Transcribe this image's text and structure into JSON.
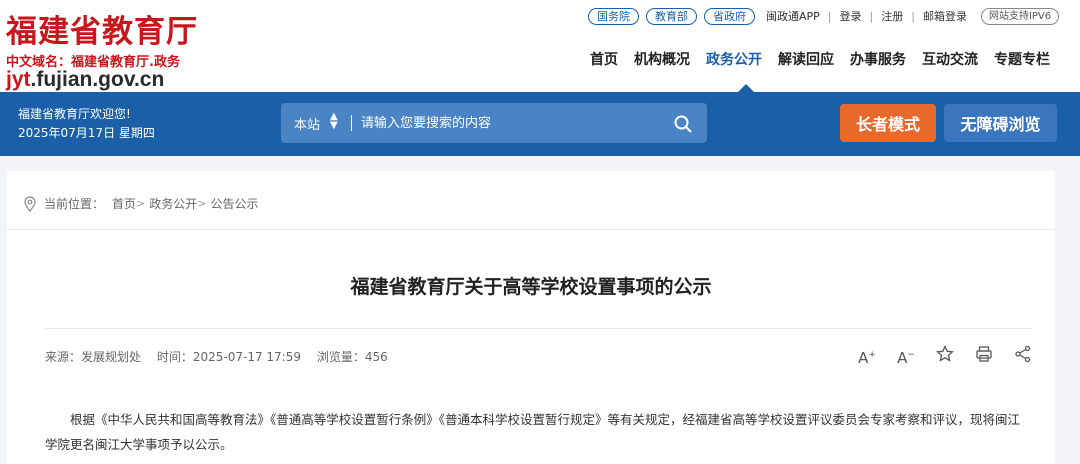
{
  "logo": {
    "title": "福建省教育厅",
    "cn_domain": "中文域名：福建省教育厅.政务",
    "url_prefix": "jyt",
    "url_rest": ".fujian.gov.cn"
  },
  "toplinks": {
    "pills": [
      "国务院",
      "教育部",
      "省政府"
    ],
    "links": [
      "闽政通APP",
      "登录",
      "注册",
      "邮箱登录"
    ],
    "ipv6": "网站支持IPV6"
  },
  "nav": {
    "items": [
      "首页",
      "机构概况",
      "政务公开",
      "解读回应",
      "办事服务",
      "互动交流",
      "专题专栏"
    ],
    "active": "政务公开"
  },
  "bluebar": {
    "welcome": "福建省教育厅欢迎您!",
    "date": "2025年07月17日 星期四",
    "search_scope": "本站",
    "search_placeholder": "请输入您要搜索的内容",
    "elder_mode": "长者模式",
    "accessible": "无障碍浏览"
  },
  "breadcrumb": {
    "label": "当前位置：",
    "items": [
      "首页",
      "政务公开",
      "公告公示"
    ]
  },
  "article": {
    "title": "福建省教育厅关于高等学校设置事项的公示",
    "source": "来源：发展规划处",
    "time": "时间：2025-07-17 17:59",
    "views": "浏览量：456",
    "body": "根据《中华人民共和国高等教育法》《普通高等学校设置暂行条例》《普通本科学校设置暂行规定》等有关规定，经福建省高等学校设置评议委员会专家考察和评议，现将闽江学院更名闽江大学事项予以公示。"
  },
  "colors": {
    "brand_red": "#c8161d",
    "brand_blue": "#1a5fa8",
    "elder_orange": "#e8692c"
  }
}
